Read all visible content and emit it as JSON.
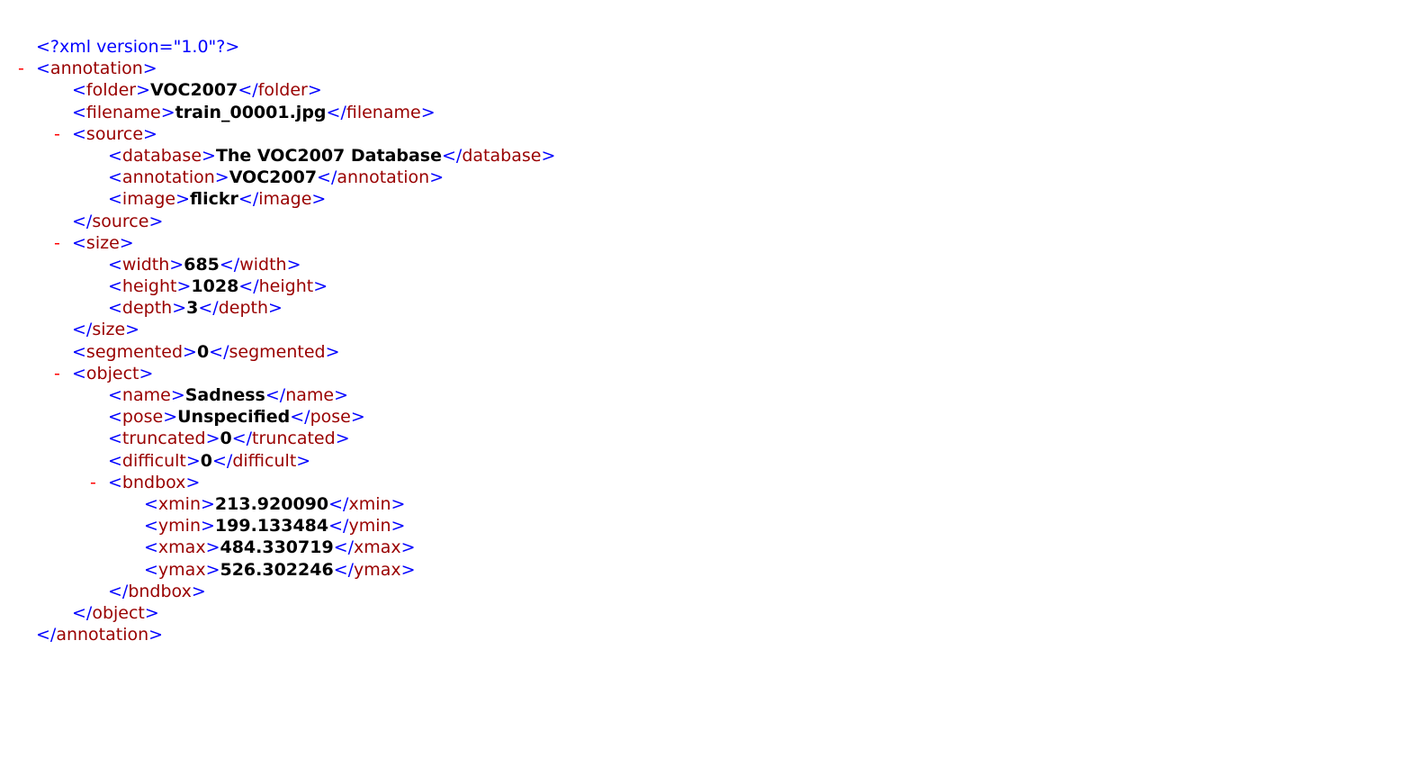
{
  "colors": {
    "markup": "#0000FF",
    "tag_name": "#990000",
    "collapse_toggle": "#FF0000",
    "value": "#000000"
  },
  "collapse_symbol": "-",
  "declaration": "<?xml version=\"1.0\"?>",
  "lines": [
    {
      "depth": 0,
      "kind": "pi"
    },
    {
      "depth": 0,
      "kind": "open",
      "tag": "annotation",
      "collapsible": true
    },
    {
      "depth": 1,
      "kind": "leaf",
      "tag": "folder",
      "value": "VOC2007"
    },
    {
      "depth": 1,
      "kind": "leaf",
      "tag": "filename",
      "value": "train_00001.jpg"
    },
    {
      "depth": 1,
      "kind": "open",
      "tag": "source",
      "collapsible": true
    },
    {
      "depth": 2,
      "kind": "leaf",
      "tag": "database",
      "value": "The VOC2007 Database"
    },
    {
      "depth": 2,
      "kind": "leaf",
      "tag": "annotation",
      "value": "VOC2007"
    },
    {
      "depth": 2,
      "kind": "leaf",
      "tag": "image",
      "value": "flickr"
    },
    {
      "depth": 1,
      "kind": "close",
      "tag": "source"
    },
    {
      "depth": 1,
      "kind": "open",
      "tag": "size",
      "collapsible": true
    },
    {
      "depth": 2,
      "kind": "leaf",
      "tag": "width",
      "value": "685"
    },
    {
      "depth": 2,
      "kind": "leaf",
      "tag": "height",
      "value": "1028"
    },
    {
      "depth": 2,
      "kind": "leaf",
      "tag": "depth",
      "value": "3"
    },
    {
      "depth": 1,
      "kind": "close",
      "tag": "size"
    },
    {
      "depth": 1,
      "kind": "leaf",
      "tag": "segmented",
      "value": "0"
    },
    {
      "depth": 1,
      "kind": "open",
      "tag": "object",
      "collapsible": true
    },
    {
      "depth": 2,
      "kind": "leaf",
      "tag": "name",
      "value": "Sadness"
    },
    {
      "depth": 2,
      "kind": "leaf",
      "tag": "pose",
      "value": "Unspecified"
    },
    {
      "depth": 2,
      "kind": "leaf",
      "tag": "truncated",
      "value": "0"
    },
    {
      "depth": 2,
      "kind": "leaf",
      "tag": "difficult",
      "value": "0"
    },
    {
      "depth": 2,
      "kind": "open",
      "tag": "bndbox",
      "collapsible": true
    },
    {
      "depth": 3,
      "kind": "leaf",
      "tag": "xmin",
      "value": "213.920090"
    },
    {
      "depth": 3,
      "kind": "leaf",
      "tag": "ymin",
      "value": "199.133484"
    },
    {
      "depth": 3,
      "kind": "leaf",
      "tag": "xmax",
      "value": "484.330719"
    },
    {
      "depth": 3,
      "kind": "leaf",
      "tag": "ymax",
      "value": "526.302246"
    },
    {
      "depth": 2,
      "kind": "close",
      "tag": "bndbox"
    },
    {
      "depth": 1,
      "kind": "close",
      "tag": "object"
    },
    {
      "depth": 0,
      "kind": "close",
      "tag": "annotation"
    }
  ]
}
